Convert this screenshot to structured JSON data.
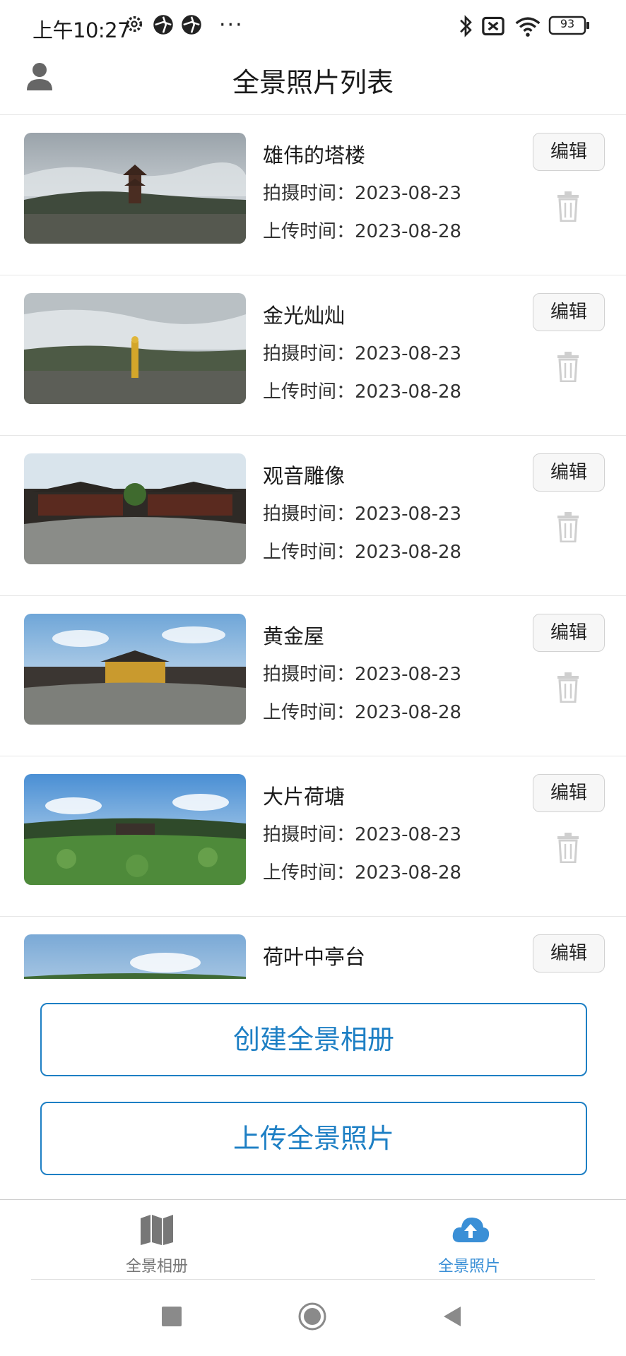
{
  "status_bar": {
    "time": "上午10:27",
    "battery": "93"
  },
  "header": {
    "title": "全景照片列表"
  },
  "photos": [
    {
      "name": "雄伟的塔楼",
      "shot": "拍摄时间：2023-08-23",
      "upload": "上传时间：2023-08-28",
      "edit": "编辑"
    },
    {
      "name": "金光灿灿",
      "shot": "拍摄时间：2023-08-23",
      "upload": "上传时间：2023-08-28",
      "edit": "编辑"
    },
    {
      "name": "观音雕像",
      "shot": "拍摄时间：2023-08-23",
      "upload": "上传时间：2023-08-28",
      "edit": "编辑"
    },
    {
      "name": "黄金屋",
      "shot": "拍摄时间：2023-08-23",
      "upload": "上传时间：2023-08-28",
      "edit": "编辑"
    },
    {
      "name": "大片荷塘",
      "shot": "拍摄时间：2023-08-23",
      "upload": "上传时间：2023-08-28",
      "edit": "编辑"
    },
    {
      "name": "荷叶中亭台",
      "shot": "",
      "upload": "",
      "edit": "编辑"
    }
  ],
  "actions": {
    "create_album": "创建全景相册",
    "upload_photo": "上传全景照片"
  },
  "tabbar": {
    "albums": "全景相册",
    "photos": "全景照片",
    "active": "photos"
  },
  "colors": {
    "accent": "#1d7fc4",
    "active_tab": "#3a8fd6",
    "inactive_tab": "#777777"
  },
  "icons": [
    "user-icon",
    "settings-icon",
    "bluetooth-icon",
    "wifi-icon",
    "battery-icon",
    "trash-icon",
    "map-icon",
    "cloud-upload-icon"
  ]
}
